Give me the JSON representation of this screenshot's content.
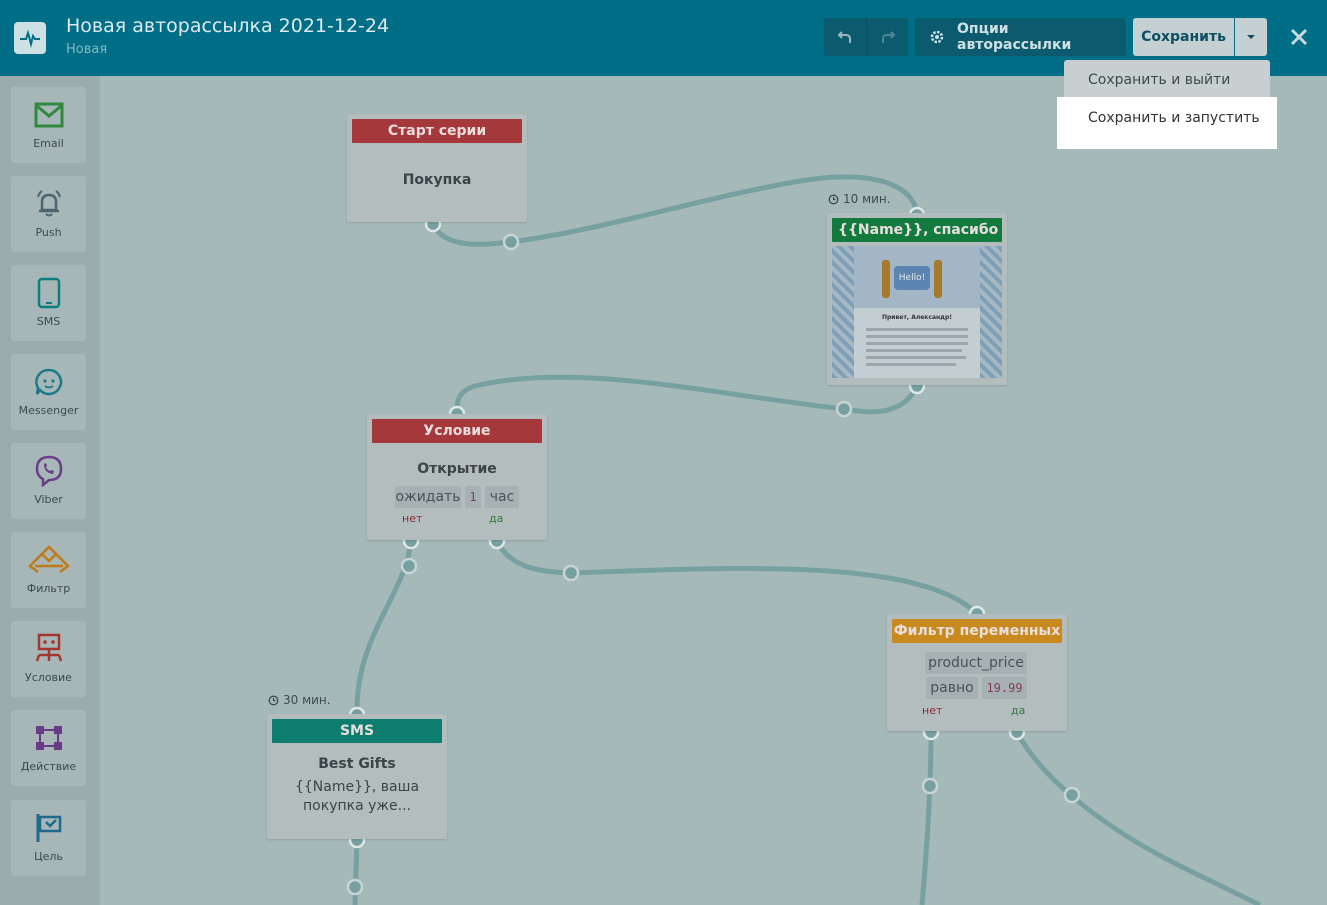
{
  "header": {
    "title": "Новая авторассылка 2021-12-24",
    "status": "Новая",
    "options_label": "Опции авторассылки",
    "save_label": "Сохранить"
  },
  "dropdown": {
    "items": [
      "Сохранить и выйти",
      "Сохранить и запустить"
    ]
  },
  "sidebar": {
    "items": [
      {
        "label": "Email",
        "icon": "email-icon",
        "color": "#2f8a3d"
      },
      {
        "label": "Push",
        "icon": "bell-icon",
        "color": "#4a6470"
      },
      {
        "label": "SMS",
        "icon": "phone-icon",
        "color": "#0b7f80"
      },
      {
        "label": "Messenger",
        "icon": "chat-icon",
        "color": "#1c7a8a"
      },
      {
        "label": "Viber",
        "icon": "viber-icon",
        "color": "#6a3d8a"
      },
      {
        "label": "Фильтр",
        "icon": "filter-icon",
        "color": "#c07a16"
      },
      {
        "label": "Условие",
        "icon": "condition-icon",
        "color": "#a3362f"
      },
      {
        "label": "Действие",
        "icon": "action-icon",
        "color": "#6a3a8a"
      },
      {
        "label": "Цель",
        "icon": "flag-icon",
        "color": "#1d6a8a"
      }
    ]
  },
  "nodes": {
    "start": {
      "header": "Старт серии",
      "text": "Покупка"
    },
    "email": {
      "header": "{{Name}}, спасибо за...",
      "delay": "10 мин.",
      "preview_greeting": "Привет, Александр!",
      "preview_badge": "Hello!"
    },
    "condition": {
      "header": "Условие",
      "text": "Открытие",
      "wait": "ожидать",
      "wait_value": "1",
      "wait_unit": "час",
      "no": "нет",
      "yes": "да"
    },
    "filter": {
      "header": "Фильтр переменных",
      "variable": "product_price",
      "operator": "равно",
      "value": "19.99",
      "no": "нет",
      "yes": "да"
    },
    "sms": {
      "header": "SMS",
      "delay": "30 мин.",
      "title": "Best Gifts",
      "line1": "{{Name}}, ваша",
      "line2": "покупка уже..."
    }
  },
  "colors": {
    "header_bg": "#006e86",
    "start_head": "#a4383a",
    "email_head": "#127a3d",
    "condition_head": "#a4383a",
    "filter_head": "#c88a1f",
    "sms_head": "#0c7d6e",
    "wire": "#77a1a1"
  }
}
